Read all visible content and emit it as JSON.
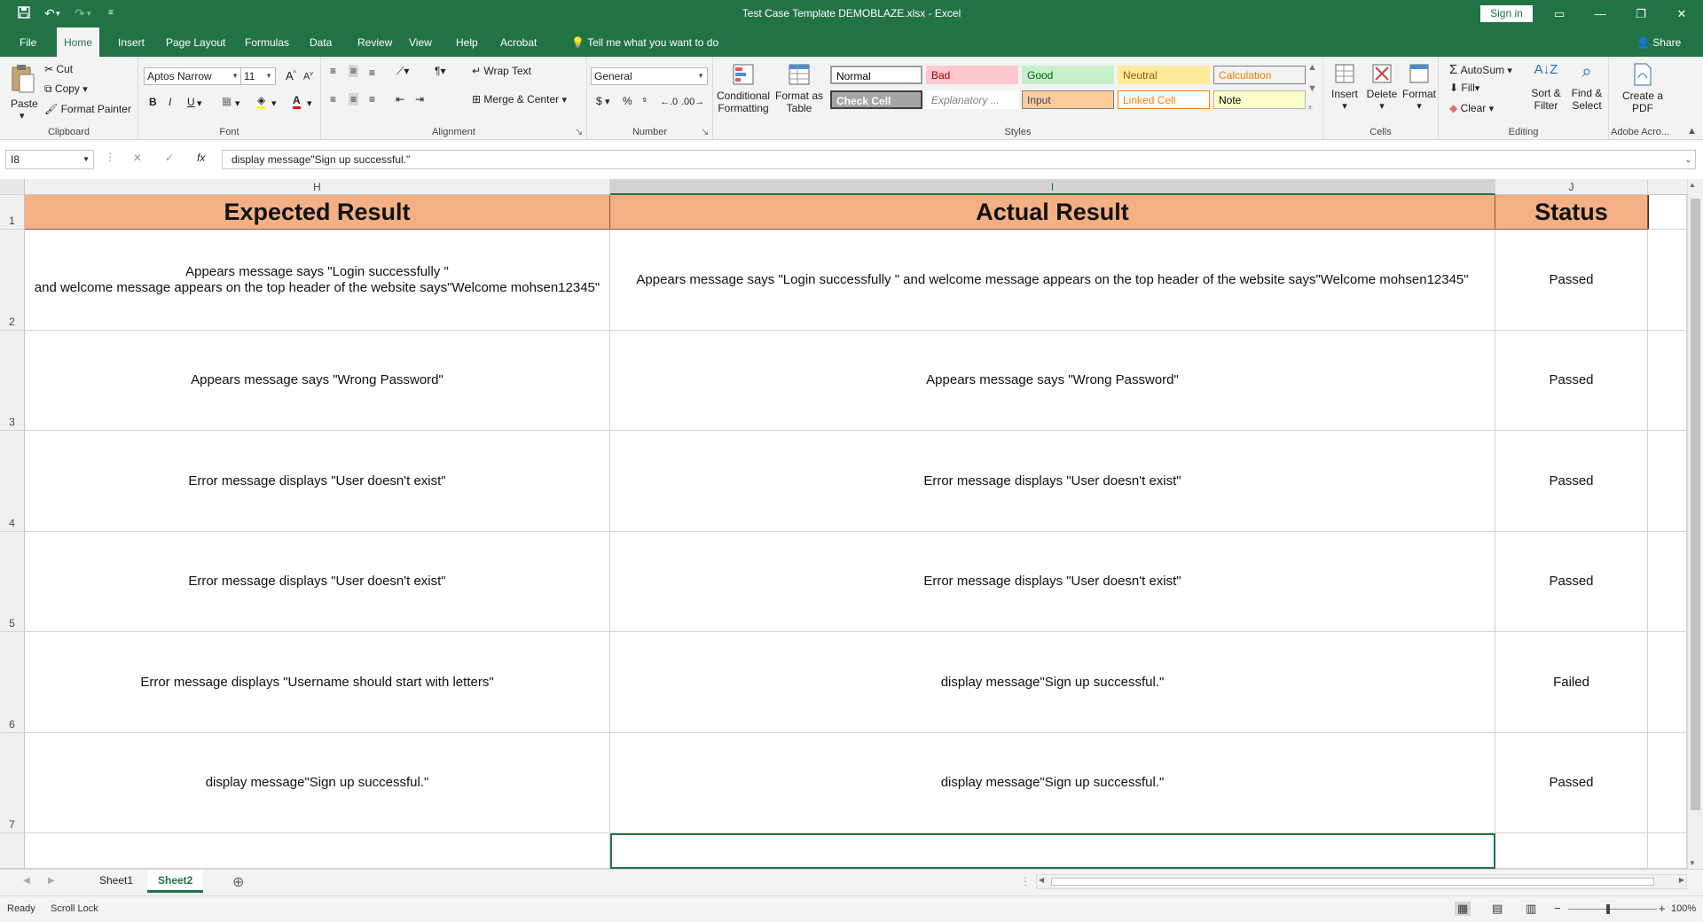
{
  "window": {
    "title": "Test Case Template DEMOBLAZE.xlsx  -  Excel",
    "sign_in": "Sign in"
  },
  "tabs": [
    "File",
    "Home",
    "Insert",
    "Page Layout",
    "Formulas",
    "Data",
    "Review",
    "View",
    "Help",
    "Acrobat"
  ],
  "active_tab": "Home",
  "tell_me": "Tell me what you want to do",
  "share": "Share",
  "ribbon": {
    "clipboard": {
      "label": "Clipboard",
      "paste": "Paste",
      "cut": "Cut",
      "copy": "Copy",
      "format_painter": "Format Painter"
    },
    "font": {
      "label": "Font",
      "name": "Aptos Narrow",
      "size": "11",
      "bold": "B",
      "italic": "I",
      "underline": "U"
    },
    "alignment": {
      "label": "Alignment",
      "wrap_text": "Wrap Text",
      "merge_center": "Merge & Center"
    },
    "number": {
      "label": "Number",
      "format": "General",
      "currency": "$",
      "percent": "%",
      "comma": "⁹"
    },
    "styles": {
      "label": "Styles",
      "conditional_formatting": "Conditional Formatting",
      "format_as_table": "Format as Table",
      "cells": [
        {
          "name": "Normal",
          "bg": "#ffffff",
          "fg": "#000000",
          "border": "#9b9b9b"
        },
        {
          "name": "Bad",
          "bg": "#ffc7ce",
          "fg": "#9c0006",
          "border": "#ffc7ce"
        },
        {
          "name": "Good",
          "bg": "#c6efce",
          "fg": "#006100",
          "border": "#c6efce"
        },
        {
          "name": "Neutral",
          "bg": "#ffeb9c",
          "fg": "#9c5700",
          "border": "#ffeb9c"
        },
        {
          "name": "Calculation",
          "bg": "#f2f2f2",
          "fg": "#fa7d00",
          "border": "#7f7f7f"
        },
        {
          "name": "Check Cell",
          "bg": "#a5a5a5",
          "fg": "#ffffff",
          "border": "#3f3f3f"
        },
        {
          "name": "Explanatory ...",
          "bg": "#ffffff",
          "fg": "#7f7f7f",
          "border": "#ffffff"
        },
        {
          "name": "Input",
          "bg": "#ffcc99",
          "fg": "#3f3f76",
          "border": "#7f7f7f"
        },
        {
          "name": "Linked Cell",
          "bg": "#ffffff",
          "fg": "#fa7d00",
          "border": "#ff8001"
        },
        {
          "name": "Note",
          "bg": "#ffffcc",
          "fg": "#000000",
          "border": "#b2b2b2"
        }
      ]
    },
    "cells": {
      "label": "Cells",
      "insert": "Insert",
      "delete": "Delete",
      "format": "Format"
    },
    "editing": {
      "label": "Editing",
      "autosum": "AutoSum",
      "fill": "Fill",
      "clear": "Clear",
      "sort_filter": "Sort & Filter",
      "find_select": "Find & Select"
    },
    "adobe": {
      "label": "Adobe Acro...",
      "create_pdf": "Create a PDF"
    }
  },
  "formula_bar": {
    "name_box": "I8",
    "formula": "display message\"Sign up successful.\""
  },
  "columns": [
    "H",
    "I",
    "J"
  ],
  "selected_column": "I",
  "header_row": {
    "number": "1",
    "cells": [
      "Expected Result",
      "Actual Result",
      "Status"
    ]
  },
  "rows": [
    {
      "number": "2",
      "expected": "Appears message says \"Login successfully \"\nand welcome message appears on the top header of the website says\"Welcome mohsen12345\"",
      "actual": "Appears message says \"Login successfully \" and welcome message appears on the top header of the website says\"Welcome mohsen12345\"",
      "status": "Passed"
    },
    {
      "number": "3",
      "expected": "Appears message says \"Wrong Password\"",
      "actual": "Appears message says \"Wrong Password\"",
      "status": "Passed"
    },
    {
      "number": "4",
      "expected": "Error message displays \"User doesn't exist\"",
      "actual": "Error message displays \"User doesn't exist\"",
      "status": "Passed"
    },
    {
      "number": "5",
      "expected": "Error message displays \"User doesn't exist\"",
      "actual": "Error message displays \"User doesn't exist\"",
      "status": "Passed"
    },
    {
      "number": "6",
      "expected": "Error message displays \"Username should start with letters\"",
      "actual": "display message\"Sign up successful.\"",
      "status": "Failed"
    },
    {
      "number": "7",
      "expected": "display message\"Sign up successful.\"",
      "actual": "display message\"Sign up successful.\"",
      "status": "Passed"
    }
  ],
  "sheets": [
    "Sheet1",
    "Sheet2"
  ],
  "active_sheet": "Sheet2",
  "status": {
    "ready": "Ready",
    "scroll_lock": "Scroll Lock",
    "zoom": "100%"
  }
}
